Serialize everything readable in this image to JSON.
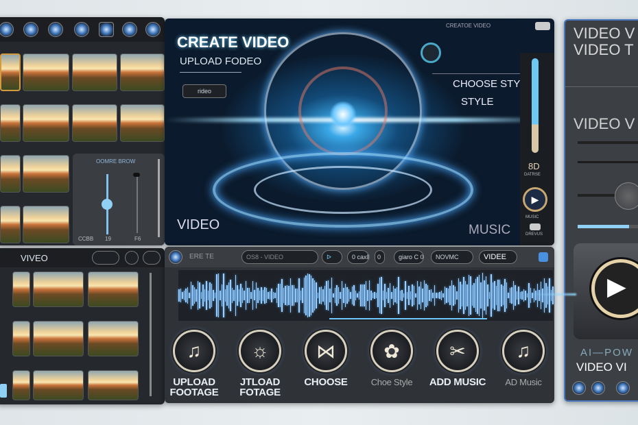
{
  "preview": {
    "title": "CREATE VIDEO",
    "subtitle": "UPLOAD FODEO",
    "small_button": "rideo",
    "top_label": "CREATOE VIDEO",
    "choose_style": "CHOOSE STYE",
    "style": "STYLE",
    "video_label": "VIDEO",
    "music_label": "MUSIC"
  },
  "side_controls": {
    "badge": "8D",
    "badge_label": "DATRSE",
    "play_label": "MUSIC",
    "bottom_label": "DREVUS"
  },
  "slider_panel": {
    "title": "OOMRE BROW",
    "labels": [
      "CCBB",
      "19",
      "F6"
    ],
    "slider_value": 0.35
  },
  "left_bottom": {
    "title": "VIVEO"
  },
  "toolbar": {
    "items": [
      "ERE TE",
      "OS8 - VIDEO",
      "ᐅ",
      "0 caxll",
      "0",
      "giaro C 0",
      "NOVMC",
      "VIDEE"
    ]
  },
  "actions": [
    {
      "label": "UPLOAD\nFOOTAGE",
      "icon": "music-note-icon"
    },
    {
      "label": "JTLOAD\nFOTAGE",
      "icon": "sun-gear-icon"
    },
    {
      "label": "CHOOSE",
      "icon": "bowtie-play-icon"
    },
    {
      "label": "Choe Style",
      "icon": "butterfly-icon"
    },
    {
      "label": "ADD MUSIC",
      "icon": "scissors-icon"
    },
    {
      "label": "AD Music",
      "icon": "music-note-icon"
    }
  ],
  "right_panel": {
    "title1": "VIDEO V",
    "title2": "VIDEO T",
    "heading": "VIDEO V",
    "caption1": "AI—POW",
    "caption2": "VIDEO VI",
    "progress": 0.75
  },
  "colors": {
    "accent": "#5ab0ff",
    "panel": "#2b2e33",
    "gold": "#d49a40"
  }
}
